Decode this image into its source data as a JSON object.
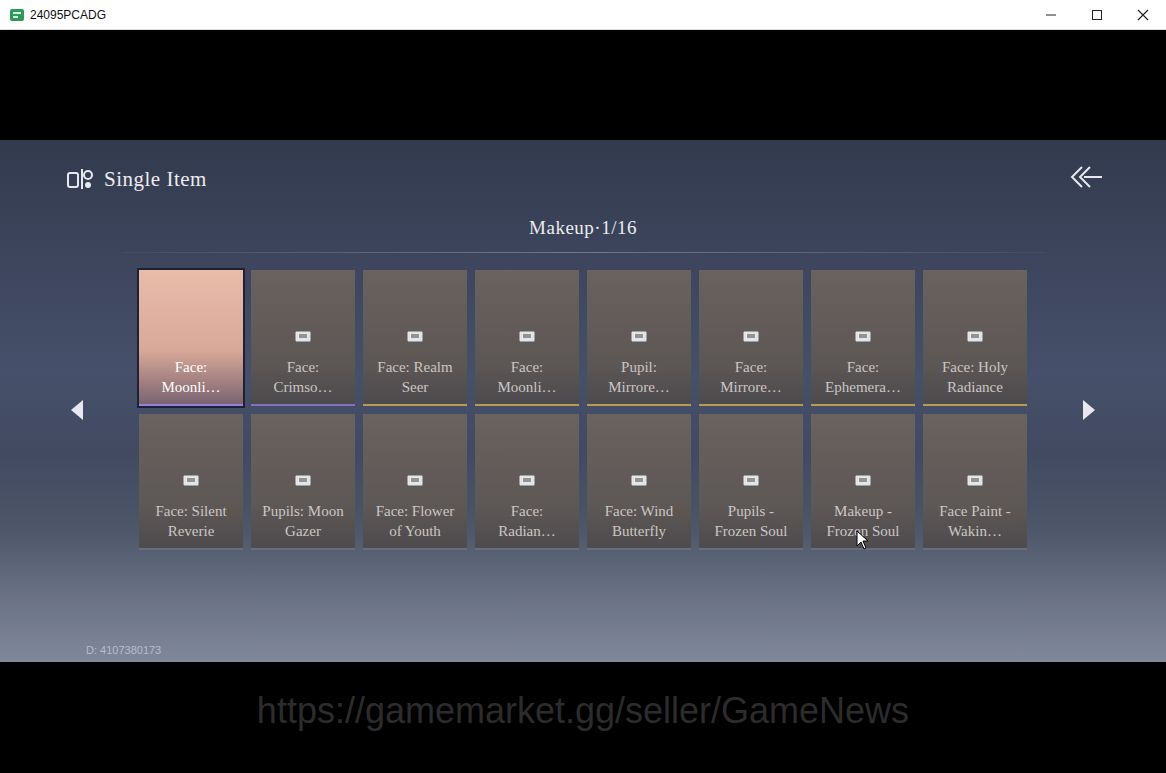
{
  "window": {
    "title": "24095PCADG"
  },
  "header": {
    "title": "Single Item"
  },
  "category": {
    "label": "Makeup·1/16"
  },
  "items": [
    {
      "name": "Face: Moonli…",
      "selected": true,
      "locked": false,
      "color": "#9a7ee0"
    },
    {
      "name": "Face: Crimso…",
      "selected": false,
      "locked": true,
      "color": "#8a72c8"
    },
    {
      "name": "Face: Realm Seer",
      "selected": false,
      "locked": true,
      "color": "#c8a050"
    },
    {
      "name": "Face: Moonli…",
      "selected": false,
      "locked": true,
      "color": "#c8a050"
    },
    {
      "name": "Pupil: Mirrore…",
      "selected": false,
      "locked": true,
      "color": "#c8a050"
    },
    {
      "name": "Face: Mirrore…",
      "selected": false,
      "locked": true,
      "color": "#c8a050"
    },
    {
      "name": "Face: Ephemera…",
      "selected": false,
      "locked": true,
      "color": "#c8a050"
    },
    {
      "name": "Face: Holy Radiance",
      "selected": false,
      "locked": true,
      "color": "#c8a050"
    },
    {
      "name": "Face: Silent Reverie",
      "selected": false,
      "locked": true,
      "color": "#6a6f80"
    },
    {
      "name": "Pupils: Moon Gazer",
      "selected": false,
      "locked": true,
      "color": "#6a6f80"
    },
    {
      "name": "Face: Flower of Youth",
      "selected": false,
      "locked": true,
      "color": "#6a6f80"
    },
    {
      "name": "Face: Radian…",
      "selected": false,
      "locked": true,
      "color": "#6a6f80"
    },
    {
      "name": "Face: Wind Butterfly",
      "selected": false,
      "locked": true,
      "color": "#6a6f80"
    },
    {
      "name": "Pupils - Frozen Soul",
      "selected": false,
      "locked": true,
      "color": "#6a6f80"
    },
    {
      "name": "Makeup - Frozen Soul",
      "selected": false,
      "locked": true,
      "color": "#6a6f80"
    },
    {
      "name": "Face Paint - Wakin…",
      "selected": false,
      "locked": true,
      "color": "#6a6f80"
    }
  ],
  "player_id": "D: 4107380173",
  "watermark": "https://gamemarket.gg/seller/GameNews"
}
